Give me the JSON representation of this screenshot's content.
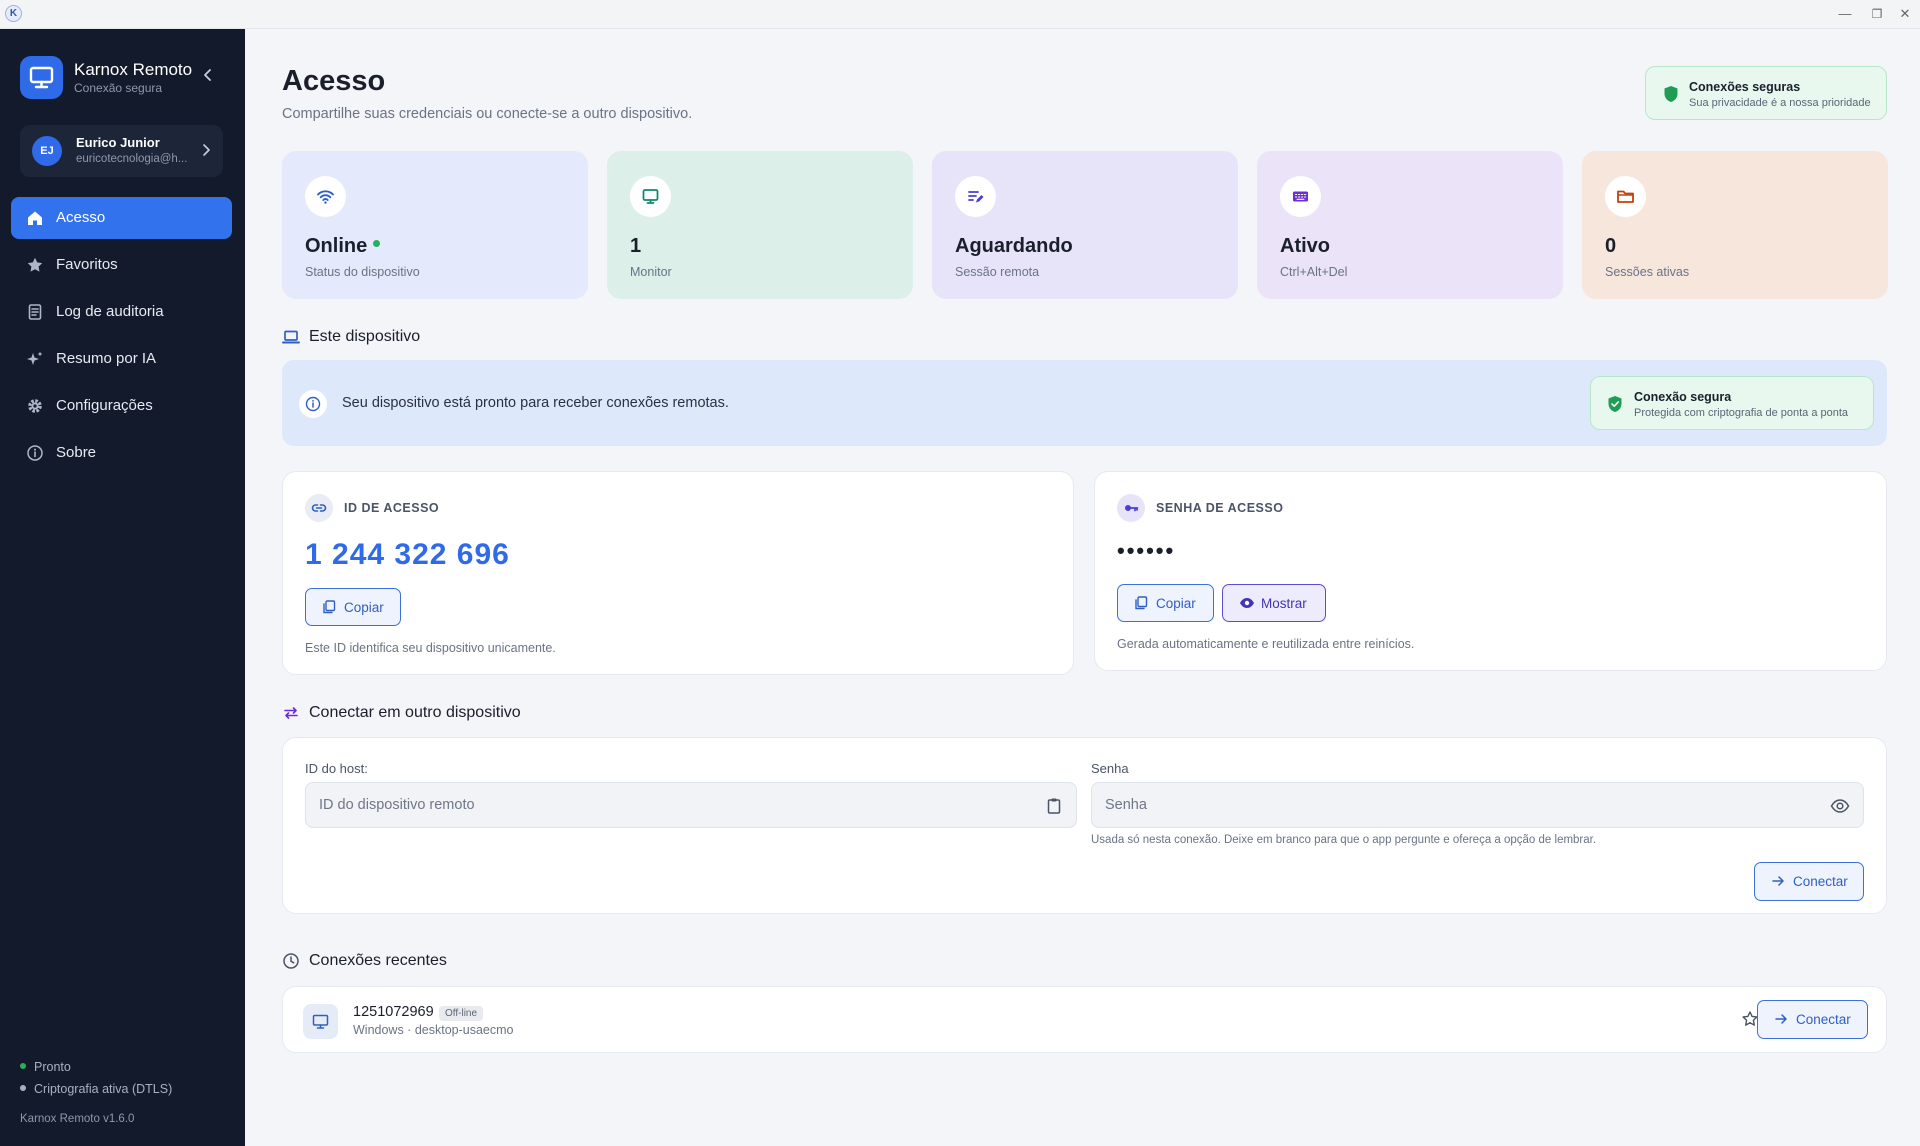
{
  "window": {
    "logo_letter": "K",
    "controls": {
      "minimize": "—",
      "restore": "❐",
      "close": "✕"
    }
  },
  "sidebar": {
    "app_name": "Karnox Remoto",
    "app_subtitle": "Conexão segura",
    "user": {
      "initials": "EJ",
      "name": "Eurico Junior",
      "email": "euricotecnologia@h..."
    },
    "nav": [
      {
        "label": "Acesso",
        "icon": "home-icon",
        "active": true
      },
      {
        "label": "Favoritos",
        "icon": "star-icon",
        "active": false
      },
      {
        "label": "Log de auditoria",
        "icon": "clipboard-list-icon",
        "active": false
      },
      {
        "label": "Resumo por IA",
        "icon": "sparkles-icon",
        "active": false
      },
      {
        "label": "Configurações",
        "icon": "gear-icon",
        "active": false
      },
      {
        "label": "Sobre",
        "icon": "info-icon",
        "active": false
      }
    ],
    "status": [
      {
        "label": "Pronto",
        "color": "#22b35b"
      },
      {
        "label": "Criptografia ativa (DTLS)",
        "color": "#a8b1c2"
      }
    ],
    "version": "Karnox Remoto v1.6.0"
  },
  "header": {
    "title": "Acesso",
    "subtitle": "Compartilhe suas credenciais ou conecte-se a outro dispositivo.",
    "secure_badge": {
      "title": "Conexões seguras",
      "subtitle": "Sua privacidade é a nossa prioridade"
    }
  },
  "stats": [
    {
      "value": "Online",
      "label": "Status do dispositivo",
      "icon": "wifi-icon",
      "bg": "#e4e9fb",
      "color": "#2f5fc4"
    },
    {
      "value": "1",
      "label": "Monitor",
      "icon": "monitor-icon",
      "bg": "#dcefe9",
      "color": "#0f8a72"
    },
    {
      "value": "Aguardando",
      "label": "Sessão remota",
      "icon": "edit-list-icon",
      "bg": "#e7e4fa",
      "color": "#4a3fd0"
    },
    {
      "value": "Ativo",
      "label": "Ctrl+Alt+Del",
      "icon": "keyboard-icon",
      "bg": "#ebe3f8",
      "color": "#6a2fd6"
    },
    {
      "value": "0",
      "label": "Sessões ativas",
      "icon": "folder-icon",
      "bg": "#f6e6dc",
      "color": "#c2410c"
    }
  ],
  "this_device": {
    "section_title": "Este dispositivo",
    "banner_text": "Seu dispositivo está pronto para receber conexões remotas.",
    "secure_badge": {
      "title": "Conexão segura",
      "subtitle": "Protegida com criptografia de ponta a ponta"
    },
    "access_id": {
      "label": "ID DE ACESSO",
      "value": "1 244 322 696",
      "copy_label": "Copiar",
      "hint": "Este ID identifica seu dispositivo unicamente."
    },
    "password": {
      "label": "SENHA DE ACESSO",
      "value": "••••••",
      "copy_label": "Copiar",
      "show_label": "Mostrar",
      "hint": "Gerada automaticamente e reutilizada entre reinícios."
    }
  },
  "connect": {
    "section_title": "Conectar em outro dispositivo",
    "host_label": "ID do host:",
    "host_placeholder": "ID do dispositivo remoto",
    "password_label": "Senha",
    "password_placeholder": "Senha",
    "password_help": "Usada só nesta conexão. Deixe em branco para que o app pergunte e ofereça a opção de lembrar.",
    "connect_label": "Conectar"
  },
  "recent": {
    "section_title": "Conexões recentes",
    "items": [
      {
        "id": "1251072969",
        "status": "Off-line",
        "meta": "Windows · desktop-usaecmo",
        "connect_label": "Conectar"
      }
    ]
  }
}
